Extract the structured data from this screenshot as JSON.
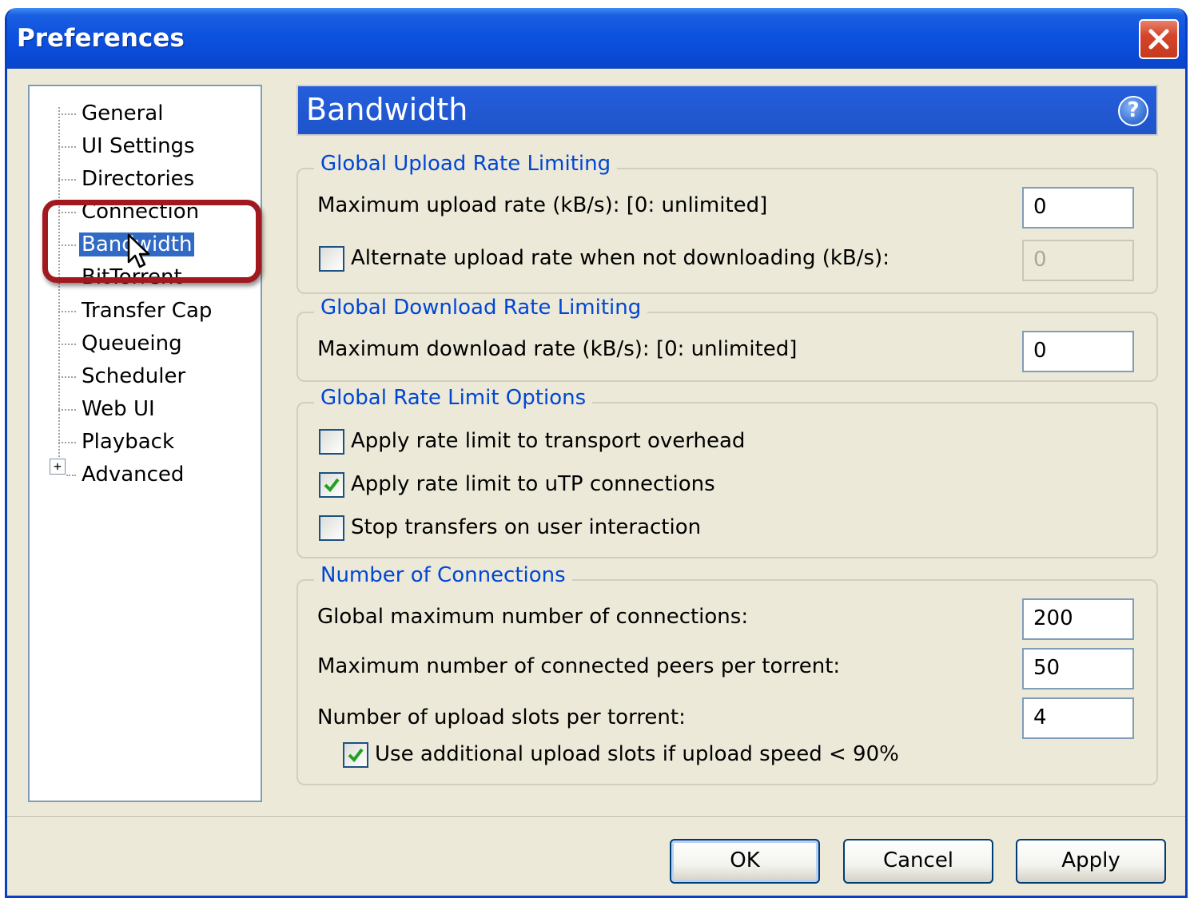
{
  "window": {
    "title": "Preferences"
  },
  "tree": {
    "items": [
      {
        "label": "General"
      },
      {
        "label": "UI Settings"
      },
      {
        "label": "Directories"
      },
      {
        "label": "Connection"
      },
      {
        "label": "Bandwidth",
        "selected": true
      },
      {
        "label": "BitTorrent"
      },
      {
        "label": "Transfer Cap"
      },
      {
        "label": "Queueing"
      },
      {
        "label": "Scheduler"
      },
      {
        "label": "Web UI"
      },
      {
        "label": "Playback"
      },
      {
        "label": "Advanced",
        "expandable": true
      }
    ],
    "expander_symbol": "+"
  },
  "header": {
    "title": "Bandwidth",
    "help_symbol": "?"
  },
  "upload_group": {
    "title": "Global Upload Rate Limiting",
    "max_label": "Maximum upload rate (kB/s): [0: unlimited]",
    "max_value": "0",
    "alt_label": "Alternate upload rate when not downloading (kB/s):",
    "alt_checked": false,
    "alt_value": "0"
  },
  "download_group": {
    "title": "Global Download Rate Limiting",
    "max_label": "Maximum download rate (kB/s): [0: unlimited]",
    "max_value": "0"
  },
  "options_group": {
    "title": "Global Rate Limit Options",
    "transport_label": "Apply rate limit to transport overhead",
    "transport_checked": false,
    "utp_label": "Apply rate limit to uTP connections",
    "utp_checked": true,
    "stop_label": "Stop transfers on user interaction",
    "stop_checked": false
  },
  "connections_group": {
    "title": "Number of Connections",
    "global_label": "Global maximum number of connections:",
    "global_value": "200",
    "peers_label": "Maximum number of connected peers per torrent:",
    "peers_value": "50",
    "slots_label": "Number of upload slots per torrent:",
    "slots_value": "4",
    "extra_label": "Use additional upload slots if upload speed < 90%",
    "extra_checked": true
  },
  "buttons": {
    "ok": "OK",
    "cancel": "Cancel",
    "apply": "Apply"
  },
  "colors": {
    "title_bar": "#0A49D6",
    "dialog_bg": "#ECE9D8",
    "group_title": "#0046D5",
    "selection": "#316AC5",
    "highlight_box": "#A2181F"
  }
}
